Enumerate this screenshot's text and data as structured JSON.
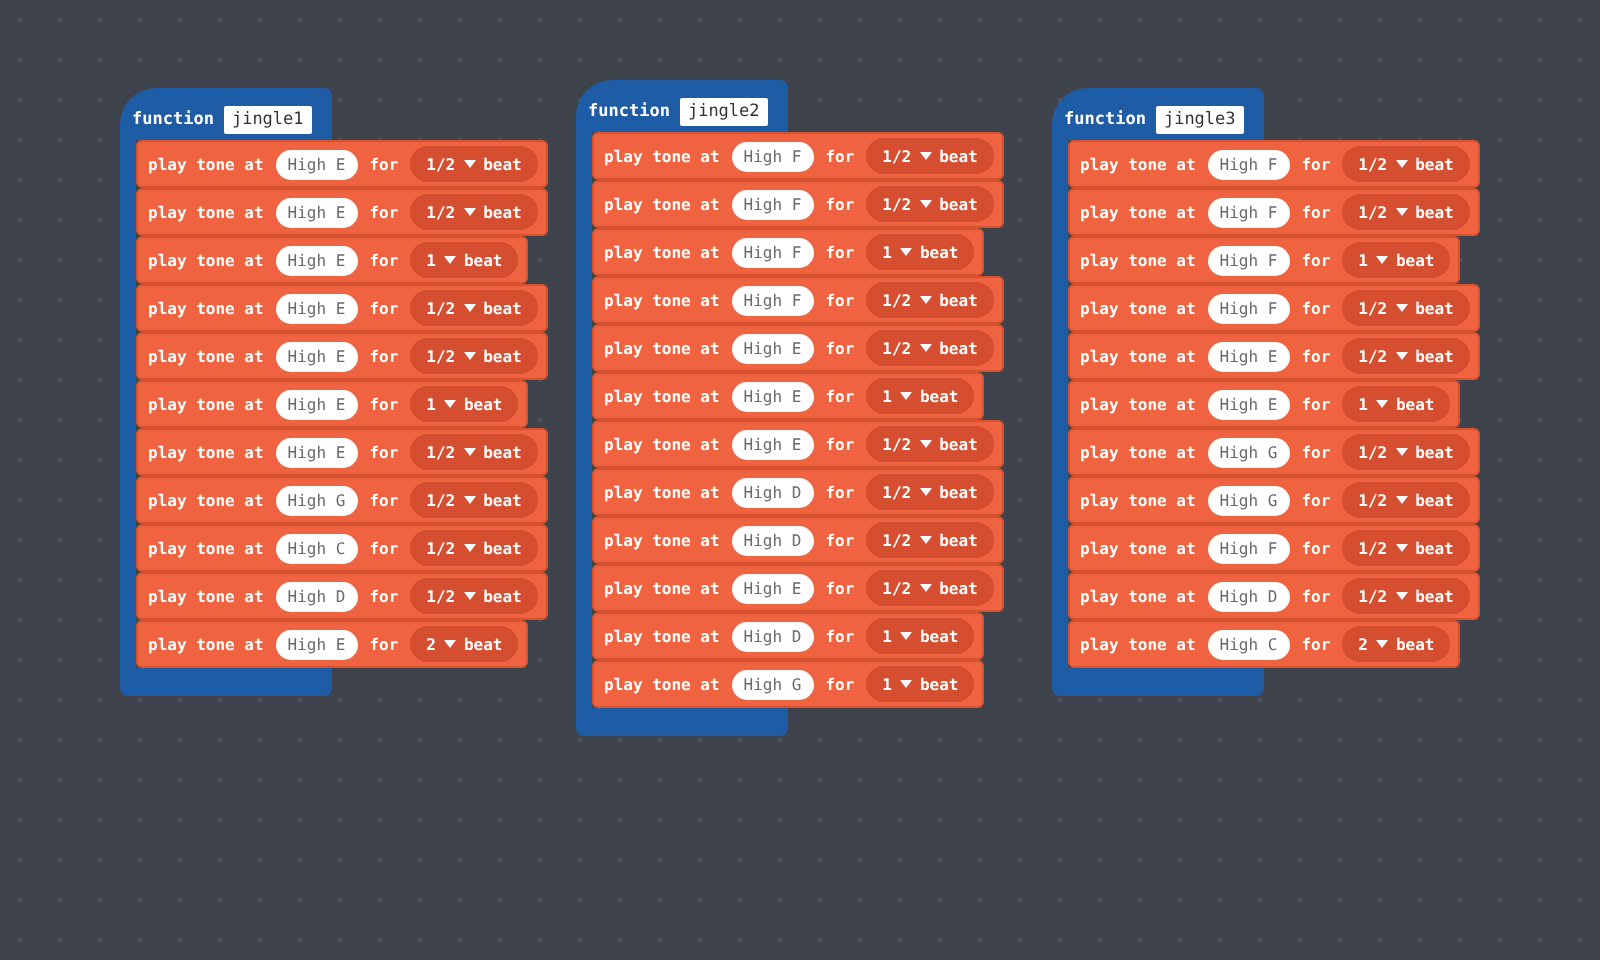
{
  "functions": [
    {
      "keyword": "function",
      "name": "jingle1",
      "blocks": [
        {
          "text": "play tone at",
          "note": "High E",
          "for": "for",
          "duration": "1/2",
          "unit": "beat"
        },
        {
          "text": "play tone at",
          "note": "High E",
          "for": "for",
          "duration": "1/2",
          "unit": "beat"
        },
        {
          "text": "play tone at",
          "note": "High E",
          "for": "for",
          "duration": "1",
          "unit": "beat"
        },
        {
          "text": "play tone at",
          "note": "High E",
          "for": "for",
          "duration": "1/2",
          "unit": "beat"
        },
        {
          "text": "play tone at",
          "note": "High E",
          "for": "for",
          "duration": "1/2",
          "unit": "beat"
        },
        {
          "text": "play tone at",
          "note": "High E",
          "for": "for",
          "duration": "1",
          "unit": "beat"
        },
        {
          "text": "play tone at",
          "note": "High E",
          "for": "for",
          "duration": "1/2",
          "unit": "beat"
        },
        {
          "text": "play tone at",
          "note": "High G",
          "for": "for",
          "duration": "1/2",
          "unit": "beat"
        },
        {
          "text": "play tone at",
          "note": "High C",
          "for": "for",
          "duration": "1/2",
          "unit": "beat"
        },
        {
          "text": "play tone at",
          "note": "High D",
          "for": "for",
          "duration": "1/2",
          "unit": "beat"
        },
        {
          "text": "play tone at",
          "note": "High E",
          "for": "for",
          "duration": "2",
          "unit": "beat"
        }
      ]
    },
    {
      "keyword": "function",
      "name": "jingle2",
      "blocks": [
        {
          "text": "play tone at",
          "note": "High F",
          "for": "for",
          "duration": "1/2",
          "unit": "beat"
        },
        {
          "text": "play tone at",
          "note": "High F",
          "for": "for",
          "duration": "1/2",
          "unit": "beat"
        },
        {
          "text": "play tone at",
          "note": "High F",
          "for": "for",
          "duration": "1",
          "unit": "beat"
        },
        {
          "text": "play tone at",
          "note": "High F",
          "for": "for",
          "duration": "1/2",
          "unit": "beat"
        },
        {
          "text": "play tone at",
          "note": "High E",
          "for": "for",
          "duration": "1/2",
          "unit": "beat"
        },
        {
          "text": "play tone at",
          "note": "High E",
          "for": "for",
          "duration": "1",
          "unit": "beat"
        },
        {
          "text": "play tone at",
          "note": "High E",
          "for": "for",
          "duration": "1/2",
          "unit": "beat"
        },
        {
          "text": "play tone at",
          "note": "High D",
          "for": "for",
          "duration": "1/2",
          "unit": "beat"
        },
        {
          "text": "play tone at",
          "note": "High D",
          "for": "for",
          "duration": "1/2",
          "unit": "beat"
        },
        {
          "text": "play tone at",
          "note": "High E",
          "for": "for",
          "duration": "1/2",
          "unit": "beat"
        },
        {
          "text": "play tone at",
          "note": "High D",
          "for": "for",
          "duration": "1",
          "unit": "beat"
        },
        {
          "text": "play tone at",
          "note": "High G",
          "for": "for",
          "duration": "1",
          "unit": "beat"
        }
      ]
    },
    {
      "keyword": "function",
      "name": "jingle3",
      "blocks": [
        {
          "text": "play tone at",
          "note": "High F",
          "for": "for",
          "duration": "1/2",
          "unit": "beat"
        },
        {
          "text": "play tone at",
          "note": "High F",
          "for": "for",
          "duration": "1/2",
          "unit": "beat"
        },
        {
          "text": "play tone at",
          "note": "High F",
          "for": "for",
          "duration": "1",
          "unit": "beat"
        },
        {
          "text": "play tone at",
          "note": "High F",
          "for": "for",
          "duration": "1/2",
          "unit": "beat"
        },
        {
          "text": "play tone at",
          "note": "High E",
          "for": "for",
          "duration": "1/2",
          "unit": "beat"
        },
        {
          "text": "play tone at",
          "note": "High E",
          "for": "for",
          "duration": "1",
          "unit": "beat"
        },
        {
          "text": "play tone at",
          "note": "High G",
          "for": "for",
          "duration": "1/2",
          "unit": "beat"
        },
        {
          "text": "play tone at",
          "note": "High G",
          "for": "for",
          "duration": "1/2",
          "unit": "beat"
        },
        {
          "text": "play tone at",
          "note": "High F",
          "for": "for",
          "duration": "1/2",
          "unit": "beat"
        },
        {
          "text": "play tone at",
          "note": "High D",
          "for": "for",
          "duration": "1/2",
          "unit": "beat"
        },
        {
          "text": "play tone at",
          "note": "High C",
          "for": "for",
          "duration": "2",
          "unit": "beat"
        }
      ]
    }
  ]
}
